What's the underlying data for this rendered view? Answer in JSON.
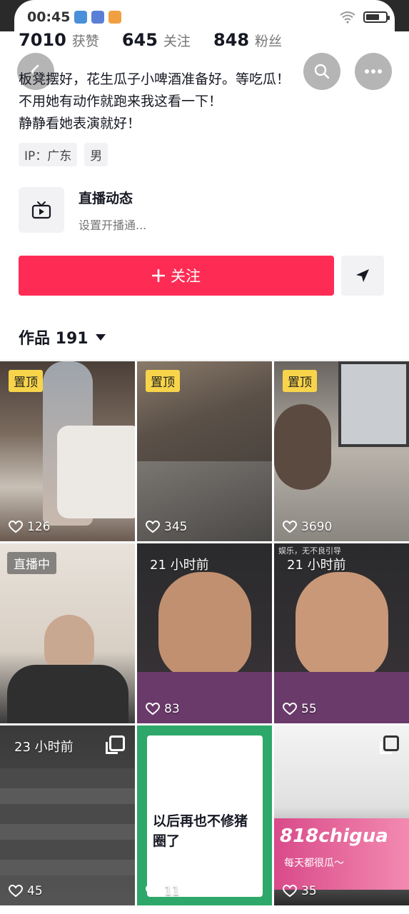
{
  "status_bar": {
    "time": "00:45"
  },
  "stats": [
    {
      "value": "7010",
      "label": "获赞"
    },
    {
      "value": "645",
      "label": "关注"
    },
    {
      "value": "848",
      "label": "粉丝"
    }
  ],
  "bio": [
    "板凳摆好，花生瓜子小啤酒准备好。等吃瓜！",
    "不用她有动作就跑来我这看一下！",
    "静静看她表演就好！"
  ],
  "tags": [
    "IP：广东",
    "男"
  ],
  "live": {
    "title": "直播动态",
    "subtitle": "设置开播通..."
  },
  "actions": {
    "follow_label": "关注"
  },
  "works": {
    "label": "作品 191"
  },
  "videos": [
    {
      "badge": "置顶",
      "likes": "126"
    },
    {
      "badge": "置顶",
      "likes": "345"
    },
    {
      "badge": "置顶",
      "likes": "3690"
    },
    {
      "badge": "直播中",
      "likes": ""
    },
    {
      "badge": "21 小时前",
      "likes": "83"
    },
    {
      "badge": "21 小时前",
      "likes": "55"
    },
    {
      "badge": "23 小时前",
      "likes": "45"
    },
    {
      "badge": "",
      "likes": "11"
    },
    {
      "badge": "",
      "likes": "35"
    }
  ],
  "overlay_texts": {
    "tile5_watermark": "娱乐，无不良引导",
    "tile7_caption": "以后再也不修猪圈了",
    "tile9_logo": "818chigua",
    "tile9_slogan": "每天都很瓜～"
  },
  "colors": {
    "accent": "#fe2c55",
    "pin_badge": "#f8d44a"
  }
}
